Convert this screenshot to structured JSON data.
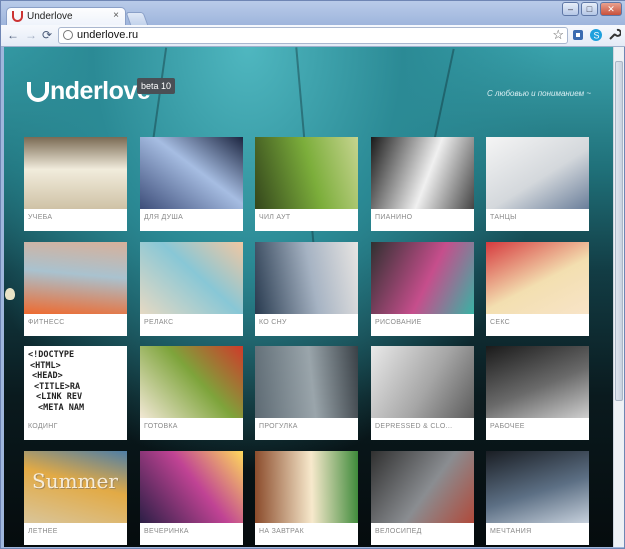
{
  "browser": {
    "tab_title": "Underlove",
    "tab_close": "×",
    "url": "underlove.ru",
    "back": "←",
    "forward": "→",
    "reload": "⟳",
    "star": "☆",
    "minimize": "–",
    "maximize": "□",
    "close": "✕"
  },
  "site": {
    "logo": "nderlove",
    "beta": "beta 10",
    "tagline": "С любовью и пониманием ~"
  },
  "tiles": [
    {
      "label": "УЧЕБА",
      "colors": [
        "#cfc2a6",
        "#f1ecdc",
        "#7a6a53"
      ]
    },
    {
      "label": "ДЛЯ ДУША",
      "colors": [
        "#3e4e7a",
        "#a6bde2",
        "#1c2540"
      ]
    },
    {
      "label": "ЧИЛ АУТ",
      "colors": [
        "#34461c",
        "#7cae3b",
        "#c6d48f"
      ]
    },
    {
      "label": "ПИАНИНО",
      "colors": [
        "#1a1a1a",
        "#f0f0f0",
        "#444"
      ]
    },
    {
      "label": "ТАНЦЫ",
      "colors": [
        "#f5f5f5",
        "#d4d8dc",
        "#6a7e9a"
      ]
    },
    {
      "label": "ФИТНЕСС",
      "colors": [
        "#ee6a2f",
        "#a9c2cf",
        "#d7b09a"
      ]
    },
    {
      "label": "РЕЛАКС",
      "colors": [
        "#e6d9c3",
        "#88c7d6",
        "#f1c7a2"
      ]
    },
    {
      "label": "КО СНУ",
      "colors": [
        "#283a4f",
        "#a6b3c3",
        "#e8e5e2"
      ]
    },
    {
      "label": "РИСОВАНИЕ",
      "colors": [
        "#303030",
        "#c64e8c",
        "#38b3a4"
      ]
    },
    {
      "label": "СЕКС",
      "colors": [
        "#d63a3e",
        "#f3dfb0",
        "#f8e4c8"
      ]
    },
    {
      "label": "КОДИНГ",
      "colors": [
        "#ffffff",
        "#222222",
        "#bdbdbd"
      ]
    },
    {
      "label": "ГОТОВКА",
      "colors": [
        "#f2e8d5",
        "#7ea43b",
        "#cf3a2a"
      ]
    },
    {
      "label": "ПРОГУЛКА",
      "colors": [
        "#5d6a73",
        "#9aa5ab",
        "#3a4147"
      ]
    },
    {
      "label": "DEPRESSED & CLO...",
      "colors": [
        "#e9e9e9",
        "#a6a6a6",
        "#5b5b5b"
      ]
    },
    {
      "label": "РАБОЧЕЕ",
      "colors": [
        "#1a1a1a",
        "#6a6a6a",
        "#cfcfcf"
      ]
    },
    {
      "label": "ЛЕТНЕЕ",
      "colors": [
        "#d9c59a",
        "#e2aa45",
        "#4e7ea6"
      ]
    },
    {
      "label": "ВЕЧЕРИНКА",
      "colors": [
        "#2c1f46",
        "#c04394",
        "#ffd95c"
      ]
    },
    {
      "label": "НА ЗАВТРАК",
      "colors": [
        "#8a4a2a",
        "#f7e9cc",
        "#3e8a3a"
      ]
    },
    {
      "label": "ВЕЛОСИПЕД",
      "colors": [
        "#303030",
        "#8a8d91",
        "#b04a3b"
      ]
    },
    {
      "label": "МЕЧТАНИЯ",
      "colors": [
        "#1a1e24",
        "#5c6f84",
        "#c6d0dc"
      ]
    }
  ],
  "summer_text": "Summer",
  "code_text": [
    "<!DOCTYPE",
    "<HTML>",
    "<HEAD>",
    "<TITLE>RA",
    "<LINK REV",
    "<META NAM"
  ],
  "theme": {
    "accent": "#2b8a95",
    "tile_bg": "#ffffff",
    "label_color": "#8a8a8a"
  }
}
